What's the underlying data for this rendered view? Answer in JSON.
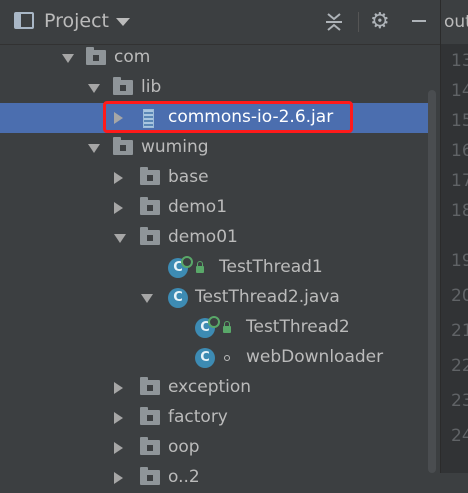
{
  "header": {
    "title": "Project",
    "icons": [
      "project-view-icon",
      "chevron-down-icon",
      "collapse-all-icon",
      "gear-icon",
      "minimize-icon"
    ]
  },
  "editor": {
    "tab_label": "out",
    "line_numbers": [
      "13",
      "14",
      "15",
      "16",
      "17",
      "18",
      "19",
      "20",
      "21",
      "22",
      "23",
      "24"
    ]
  },
  "tree": {
    "com": "com",
    "lib": "lib",
    "jar": "commons-io-2.6.jar",
    "wuming": "wuming",
    "base": "base",
    "demo1": "demo1",
    "demo01": "demo01",
    "testthread1": "TestThread1",
    "testthread2_file": "TestThread2.java",
    "testthread2": "TestThread2",
    "webdownloader": "webDownloader",
    "exception": "exception",
    "factory": "factory",
    "oop": "oop",
    "partial": "o..2"
  },
  "class_icon_letter": "C",
  "colors": {
    "selection": "#4b6eaf",
    "highlight_box": "#ff1a1a",
    "class_icon": "#3d8bb3",
    "background": "#3c3f41"
  }
}
